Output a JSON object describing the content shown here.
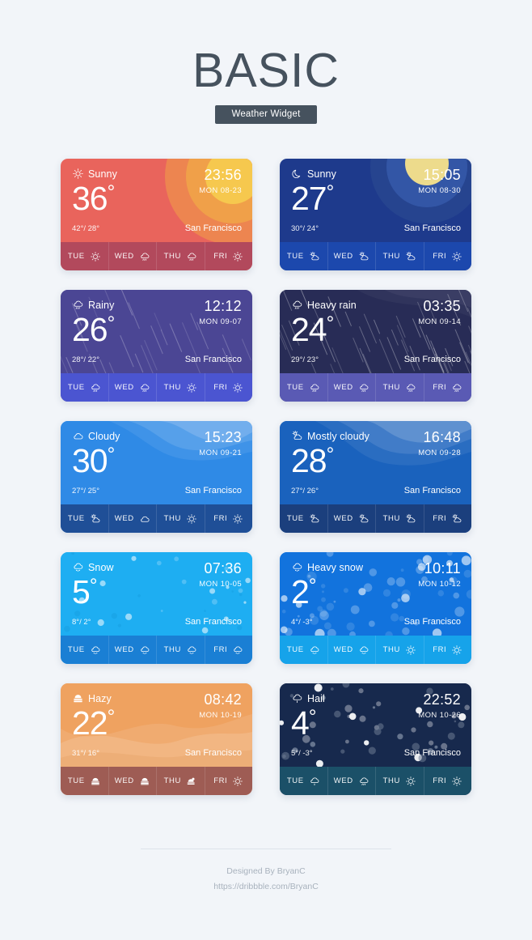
{
  "header": {
    "title": "BASIC",
    "subtitle": "Weather Widget"
  },
  "footer": {
    "designer": "Designed By BryanC",
    "link": "https://dribbble.com/BryanC"
  },
  "cards": [
    {
      "condition": "Sunny",
      "condition_icon": "sun-icon",
      "temp": "36",
      "degree": "°",
      "range": "42°/ 28°",
      "time": "23:56",
      "date": "MON  08-23",
      "city": "San Francisco",
      "theme": "sunny-day",
      "bg": "#e9645c",
      "footer_bg": "#b2495c",
      "forecast": [
        {
          "day": "TUE",
          "icon": "sun-icon"
        },
        {
          "day": "WED",
          "icon": "rain-icon"
        },
        {
          "day": "THU",
          "icon": "rain-icon"
        },
        {
          "day": "FRI",
          "icon": "sun-icon"
        }
      ]
    },
    {
      "condition": "Sunny",
      "condition_icon": "moon-icon",
      "temp": "27",
      "degree": "°",
      "range": "30°/ 24°",
      "time": "15:05",
      "date": "MON  08-30",
      "city": "San Francisco",
      "theme": "sunny-night",
      "bg": "#1e3a8c",
      "footer_bg": "#1c48ad",
      "forecast": [
        {
          "day": "TUE",
          "icon": "partly-cloudy-icon"
        },
        {
          "day": "WED",
          "icon": "partly-cloudy-icon"
        },
        {
          "day": "THU",
          "icon": "partly-cloudy-icon"
        },
        {
          "day": "FRI",
          "icon": "sun-icon"
        }
      ]
    },
    {
      "condition": "Rainy",
      "condition_icon": "rain-icon",
      "temp": "26",
      "degree": "°",
      "range": "28°/ 22°",
      "time": "12:12",
      "date": "MON  09-07",
      "city": "San Francisco",
      "theme": "rainy",
      "bg": "#4b4694",
      "footer_bg": "#4b55d1",
      "forecast": [
        {
          "day": "TUE",
          "icon": "rain-icon"
        },
        {
          "day": "WED",
          "icon": "rain-icon"
        },
        {
          "day": "THU",
          "icon": "sun-icon"
        },
        {
          "day": "FRI",
          "icon": "sun-icon"
        }
      ]
    },
    {
      "condition": "Heavy rain",
      "condition_icon": "rain-icon",
      "temp": "24",
      "degree": "°",
      "range": "29°/ 23°",
      "time": "03:35",
      "date": "MON  09-14",
      "city": "San Francisco",
      "theme": "heavy-rain",
      "bg": "#282c56",
      "footer_bg": "#5a5ab4",
      "forecast": [
        {
          "day": "TUE",
          "icon": "rain-icon"
        },
        {
          "day": "WED",
          "icon": "rain-icon"
        },
        {
          "day": "THU",
          "icon": "rain-icon"
        },
        {
          "day": "FRI",
          "icon": "rain-icon"
        }
      ]
    },
    {
      "condition": "Cloudy",
      "condition_icon": "cloud-icon",
      "temp": "30",
      "degree": "°",
      "range": "27°/ 25°",
      "time": "15:23",
      "date": "MON  09-21",
      "city": "San Francisco",
      "theme": "cloudy",
      "bg": "#2f8ae6",
      "footer_bg": "#1f4f97",
      "forecast": [
        {
          "day": "TUE",
          "icon": "partly-cloudy-icon"
        },
        {
          "day": "WED",
          "icon": "cloud-icon"
        },
        {
          "day": "THU",
          "icon": "sun-icon"
        },
        {
          "day": "FRI",
          "icon": "sun-icon"
        }
      ]
    },
    {
      "condition": "Mostly cloudy",
      "condition_icon": "partly-cloudy-icon",
      "temp": "28",
      "degree": "°",
      "range": "27°/ 26°",
      "time": "16:48",
      "date": "MON  09-28",
      "city": "San Francisco",
      "theme": "mostly-cloudy",
      "bg": "#1a62bd",
      "footer_bg": "#1b3f7d",
      "forecast": [
        {
          "day": "TUE",
          "icon": "partly-cloudy-icon"
        },
        {
          "day": "WED",
          "icon": "partly-cloudy-icon"
        },
        {
          "day": "THU",
          "icon": "partly-cloudy-icon"
        },
        {
          "day": "FRI",
          "icon": "partly-cloudy-icon"
        }
      ]
    },
    {
      "condition": "Snow",
      "condition_icon": "snow-icon",
      "temp": "5",
      "degree": "°",
      "range": "8°/ 2°",
      "time": "07:36",
      "date": "MON  10-05",
      "city": "San Francisco",
      "theme": "snow",
      "bg": "#1eaef2",
      "footer_bg": "#1a7fd4",
      "forecast": [
        {
          "day": "TUE",
          "icon": "snow-icon"
        },
        {
          "day": "WED",
          "icon": "snow-icon"
        },
        {
          "day": "THU",
          "icon": "snow-icon"
        },
        {
          "day": "FRI",
          "icon": "snow-icon"
        }
      ]
    },
    {
      "condition": "Heavy snow",
      "condition_icon": "snow-icon",
      "temp": "2",
      "degree": "°",
      "range": "4°/ -3°",
      "time": "10:11",
      "date": "MON  10-12",
      "city": "San Francisco",
      "theme": "heavy-snow",
      "bg": "#1273dd",
      "footer_bg": "#16a3ea",
      "forecast": [
        {
          "day": "TUE",
          "icon": "snow-icon"
        },
        {
          "day": "WED",
          "icon": "snow-icon"
        },
        {
          "day": "THU",
          "icon": "sun-icon"
        },
        {
          "day": "FRI",
          "icon": "sun-icon"
        }
      ]
    },
    {
      "condition": "Hazy",
      "condition_icon": "haze-icon",
      "temp": "22",
      "degree": "°",
      "range": "31°/ 16°",
      "time": "08:42",
      "date": "MON  10-19",
      "city": "San Francisco",
      "theme": "hazy",
      "bg": "#efa260",
      "footer_bg": "#9e5c54",
      "forecast": [
        {
          "day": "TUE",
          "icon": "haze-icon"
        },
        {
          "day": "WED",
          "icon": "haze-icon"
        },
        {
          "day": "THU",
          "icon": "haze-sun-icon"
        },
        {
          "day": "FRI",
          "icon": "sun-icon"
        }
      ]
    },
    {
      "condition": "Hail",
      "condition_icon": "hail-icon",
      "temp": "4",
      "degree": "°",
      "range": "5°/ -3°",
      "time": "22:52",
      "date": "MON  10-26",
      "city": "San Francisco",
      "theme": "hail",
      "bg": "#17294d",
      "footer_bg": "#1b5068",
      "forecast": [
        {
          "day": "TUE",
          "icon": "hail-icon"
        },
        {
          "day": "WED",
          "icon": "rain-icon"
        },
        {
          "day": "THU",
          "icon": "sun-icon"
        },
        {
          "day": "FRI",
          "icon": "sun-icon"
        }
      ]
    }
  ]
}
